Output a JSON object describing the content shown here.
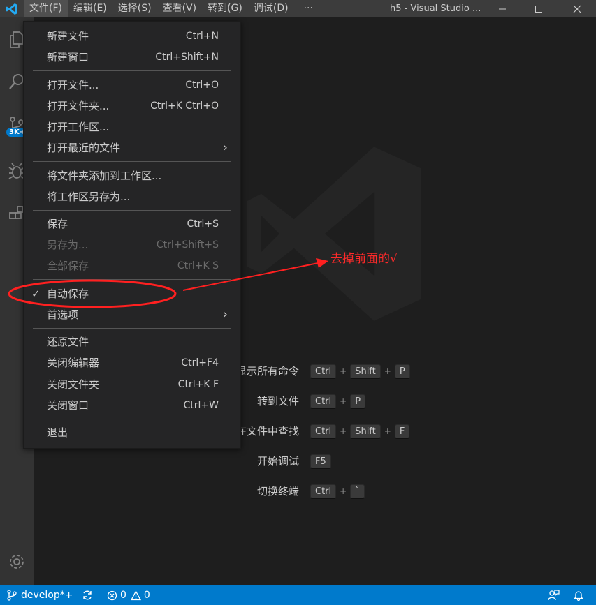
{
  "titlebar": {
    "menus": [
      "文件(F)",
      "编辑(E)",
      "选择(S)",
      "查看(V)",
      "转到(G)",
      "调试(D)"
    ],
    "more": "···",
    "window_title": "h5 - Visual Studio ...",
    "logo_color": "#23a9f2"
  },
  "activity": {
    "icons": [
      "files-icon",
      "search-icon",
      "source-control-icon",
      "debug-icon",
      "extensions-icon"
    ],
    "badge": "3K+",
    "settings_icon": "gear-icon"
  },
  "file_menu": {
    "items": [
      {
        "label": "新建文件",
        "accel": "Ctrl+N"
      },
      {
        "label": "新建窗口",
        "accel": "Ctrl+Shift+N"
      },
      {
        "label": "打开文件...",
        "accel": "Ctrl+O"
      },
      {
        "label": "打开文件夹...",
        "accel": "Ctrl+K Ctrl+O"
      },
      {
        "label": "打开工作区...",
        "accel": ""
      },
      {
        "label": "打开最近的文件",
        "accel": ""
      },
      {
        "label": "将文件夹添加到工作区...",
        "accel": ""
      },
      {
        "label": "将工作区另存为...",
        "accel": ""
      },
      {
        "label": "保存",
        "accel": "Ctrl+S"
      },
      {
        "label": "另存为...",
        "accel": "Ctrl+Shift+S"
      },
      {
        "label": "全部保存",
        "accel": "Ctrl+K S"
      },
      {
        "label": "自动保存",
        "accel": "",
        "checked": true
      },
      {
        "label": "首选项",
        "accel": ""
      },
      {
        "label": "还原文件",
        "accel": ""
      },
      {
        "label": "关闭编辑器",
        "accel": "Ctrl+F4"
      },
      {
        "label": "关闭文件夹",
        "accel": "Ctrl+K F"
      },
      {
        "label": "关闭窗口",
        "accel": "Ctrl+W"
      },
      {
        "label": "退出",
        "accel": ""
      }
    ],
    "check_mark": "✓",
    "submenu_chevron": "›"
  },
  "shortcuts": [
    {
      "label": "显示所有命令",
      "keys": [
        "Ctrl",
        "Shift",
        "P"
      ]
    },
    {
      "label": "转到文件",
      "keys": [
        "Ctrl",
        "P"
      ]
    },
    {
      "label": "在文件中查找",
      "keys": [
        "Ctrl",
        "Shift",
        "F"
      ]
    },
    {
      "label": "开始调试",
      "keys": [
        "F5"
      ]
    },
    {
      "label": "切换终端",
      "keys": [
        "Ctrl",
        "`"
      ]
    }
  ],
  "annotation": {
    "text": "去掉前面的√",
    "color": "#ff2a2a"
  },
  "statusbar": {
    "branch": "develop*+",
    "errors": "0",
    "warnings": "0",
    "color": "#007acc"
  }
}
